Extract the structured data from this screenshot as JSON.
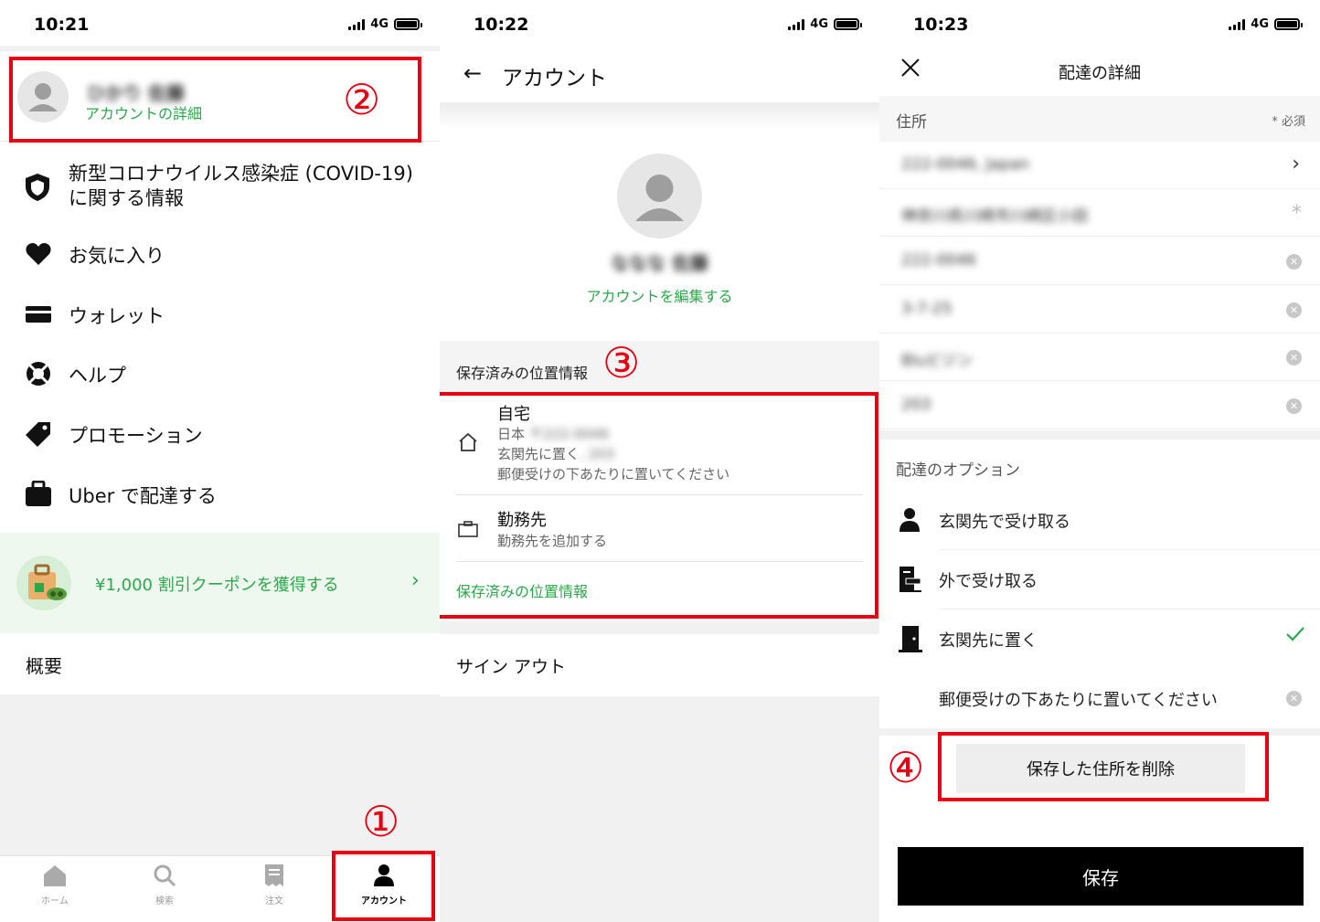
{
  "annotations": {
    "one": "①",
    "two": "②",
    "three": "③",
    "four": "④"
  },
  "panel1": {
    "status": {
      "time": "10:21",
      "network": "4G"
    },
    "profile": {
      "name": "ひかり 佐藤",
      "link": "アカウントの詳細"
    },
    "menu": [
      {
        "label": "新型コロナウイルス感染症 (COVID-19)",
        "label2": "に関する情報",
        "icon": "shield-icon"
      },
      {
        "label": "お気に入り",
        "icon": "heart-icon"
      },
      {
        "label": "ウォレット",
        "icon": "wallet-icon"
      },
      {
        "label": "ヘルプ",
        "icon": "lifebuoy-icon"
      },
      {
        "label": "プロモーション",
        "icon": "tag-icon"
      },
      {
        "label": "Uber で配達する",
        "icon": "bag-icon"
      }
    ],
    "promo": {
      "text": "¥1,000 割引クーポンを獲得する",
      "icon": "grocery-bag-icon"
    },
    "about": "概要",
    "tabs": [
      {
        "label": "ホーム",
        "icon": "home-icon"
      },
      {
        "label": "検索",
        "icon": "search-icon"
      },
      {
        "label": "注文",
        "icon": "receipt-icon"
      },
      {
        "label": "アカウント",
        "icon": "person-icon"
      }
    ]
  },
  "panel2": {
    "status": {
      "time": "10:22",
      "network": "4G"
    },
    "header_title": "アカウント",
    "profile": {
      "name": "ななな 佐藤",
      "edit_link": "アカウントを編集する"
    },
    "saved_section_title": "保存済みの位置情報",
    "places": [
      {
        "title": "自宅",
        "line1_prefix": "日本",
        "line1_blur": "〒222-0046",
        "line2_prefix": "玄関先に置く",
        "line2_blur": ", 203",
        "line3": "郵便受けの下あたりに置いてください",
        "icon": "home-outline-icon"
      },
      {
        "title": "勤務先",
        "line1_prefix": "勤務先を追加する",
        "icon": "briefcase-icon"
      }
    ],
    "saved_link": "保存済みの位置情報",
    "sign_out": "サイン アウト"
  },
  "panel3": {
    "status": {
      "time": "10:23",
      "network": "4G"
    },
    "header_title": "配達の詳細",
    "address_label": "住所",
    "required": "* 必須",
    "fields": [
      {
        "value": "222-0046, Japan"
      },
      {
        "value": "神奈川県川崎市川崎区小田"
      },
      {
        "value": "222-0046"
      },
      {
        "value": "3-7-25"
      },
      {
        "value": "Bluビジン"
      },
      {
        "value": "203"
      }
    ],
    "options_label": "配達のオプション",
    "options": [
      {
        "label": "玄関先で受け取る",
        "icon": "person-icon"
      },
      {
        "label": "外で受け取る",
        "icon": "outside-handoff-icon"
      },
      {
        "label": "玄関先に置く",
        "icon": "door-icon"
      },
      {
        "label": "郵便受けの下あたりに置いてください"
      }
    ],
    "delete_button": "保存した住所を削除",
    "save_button": "保存"
  }
}
